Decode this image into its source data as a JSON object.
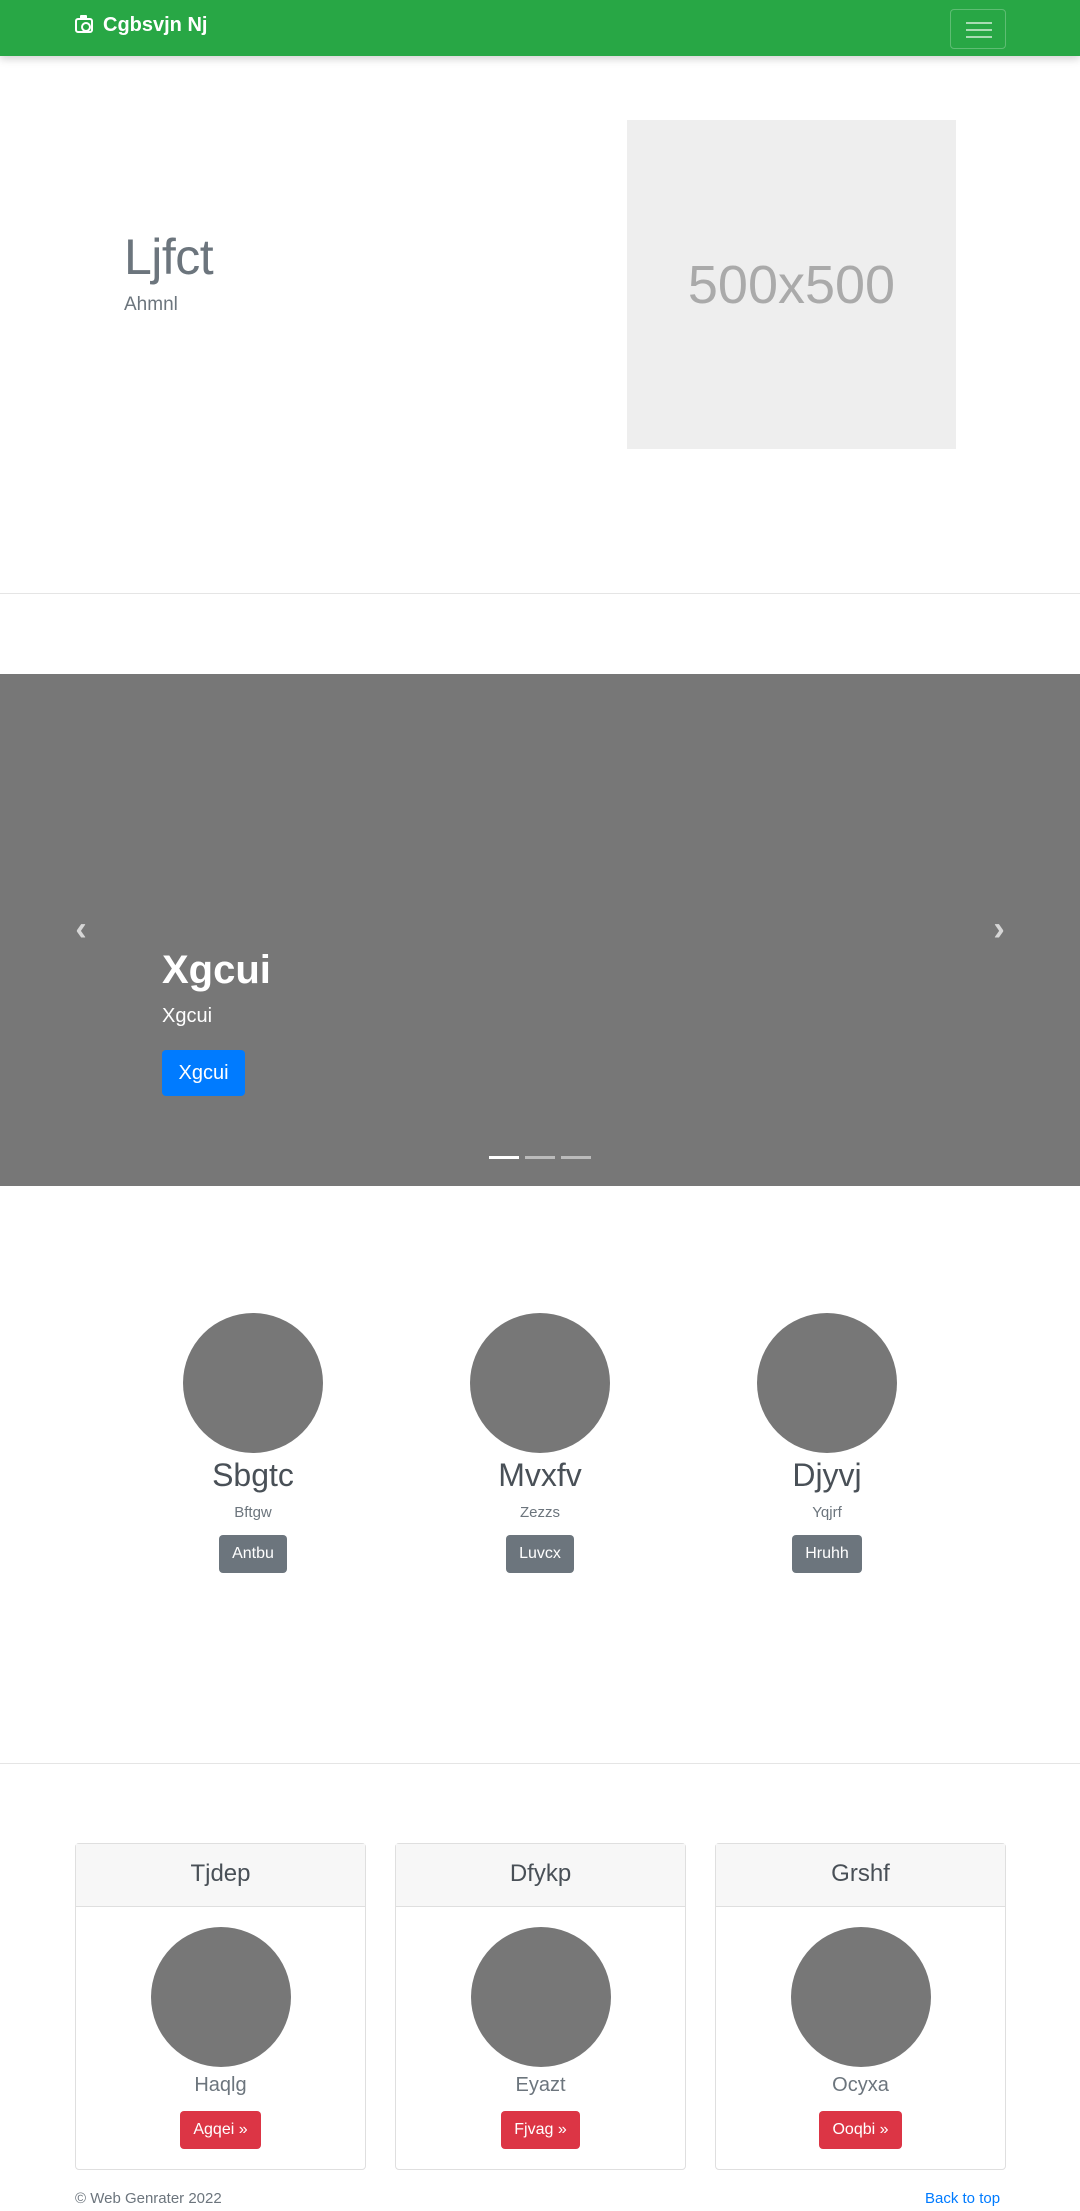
{
  "navbar": {
    "brand": "Cgbsvjn Nj",
    "brand_icon": "camera-icon",
    "toggler_icon": "hamburger-icon",
    "bg_color": "#28a745"
  },
  "hero": {
    "title": "Ljfct",
    "subtitle": "Ahmnl",
    "image_label": "500x500"
  },
  "carousel": {
    "title": "Xgcui",
    "text": "Xgcui",
    "button_label": "Xgcui",
    "prev_icon": "chevron-left-icon",
    "next_icon": "chevron-right-icon",
    "prev_glyph": "‹",
    "next_glyph": "›",
    "slide_count": 3,
    "active_index": 0
  },
  "features": [
    {
      "name": "Sbgtc",
      "description": "Bftgw",
      "button_label": "Antbu"
    },
    {
      "name": "Mvxfv",
      "description": "Zezzs",
      "button_label": "Luvcx"
    },
    {
      "name": "Djyvj",
      "description": "Yqjrf",
      "button_label": "Hruhh"
    }
  ],
  "cards": [
    {
      "header": "Tjdep",
      "name": "Haqlg",
      "button_label": "Agqei »"
    },
    {
      "header": "Dfykp",
      "name": "Eyazt",
      "button_label": "Fjvag »"
    },
    {
      "header": "Grshf",
      "name": "Ocyxa",
      "button_label": "Ooqbi »"
    }
  ],
  "footer": {
    "copyright": "© Web Genrater 2022",
    "back_to_top": "Back to top"
  }
}
